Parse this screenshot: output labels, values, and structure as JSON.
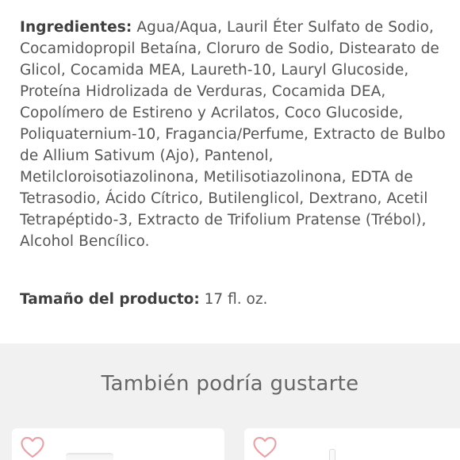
{
  "product_details": {
    "ingredients_label": "Ingredientes:",
    "ingredients_text": " Agua/Aqua, Lauril Éter Sulfato de Sodio, Cocamidopropil Betaína, Cloruro de Sodio, Distearato de Glicol, Cocamida MEA, Laureth-10, Lauryl Glucoside, Proteína Hidrolizada de Verduras, Cocamida DEA, Copolímero de Estireno y Acrilatos, Coco Glucoside, Poliquaternium-10, Fragancia/Perfume, Extracto de Bulbo de Allium Sativum (Ajo), Pantenol, Metilcloroisotiazolinona, Metilisotiazolinona, EDTA de Tetrasodio, Ácido Cítrico, Butilenglicol, Dextrano, Acetil Tetrapéptido-3, Extracto de Trifolium Pratense (Trébol), Alcohol Bencílico.",
    "size_label": "Tamaño del producto:",
    "size_value": " 17 fl. oz."
  },
  "recommendations": {
    "title": "También podría gustarte",
    "heart_color": "#e8a3a8",
    "cards": [
      {
        "favorite_icon": "heart-outline-icon"
      },
      {
        "favorite_icon": "heart-outline-icon"
      }
    ]
  }
}
